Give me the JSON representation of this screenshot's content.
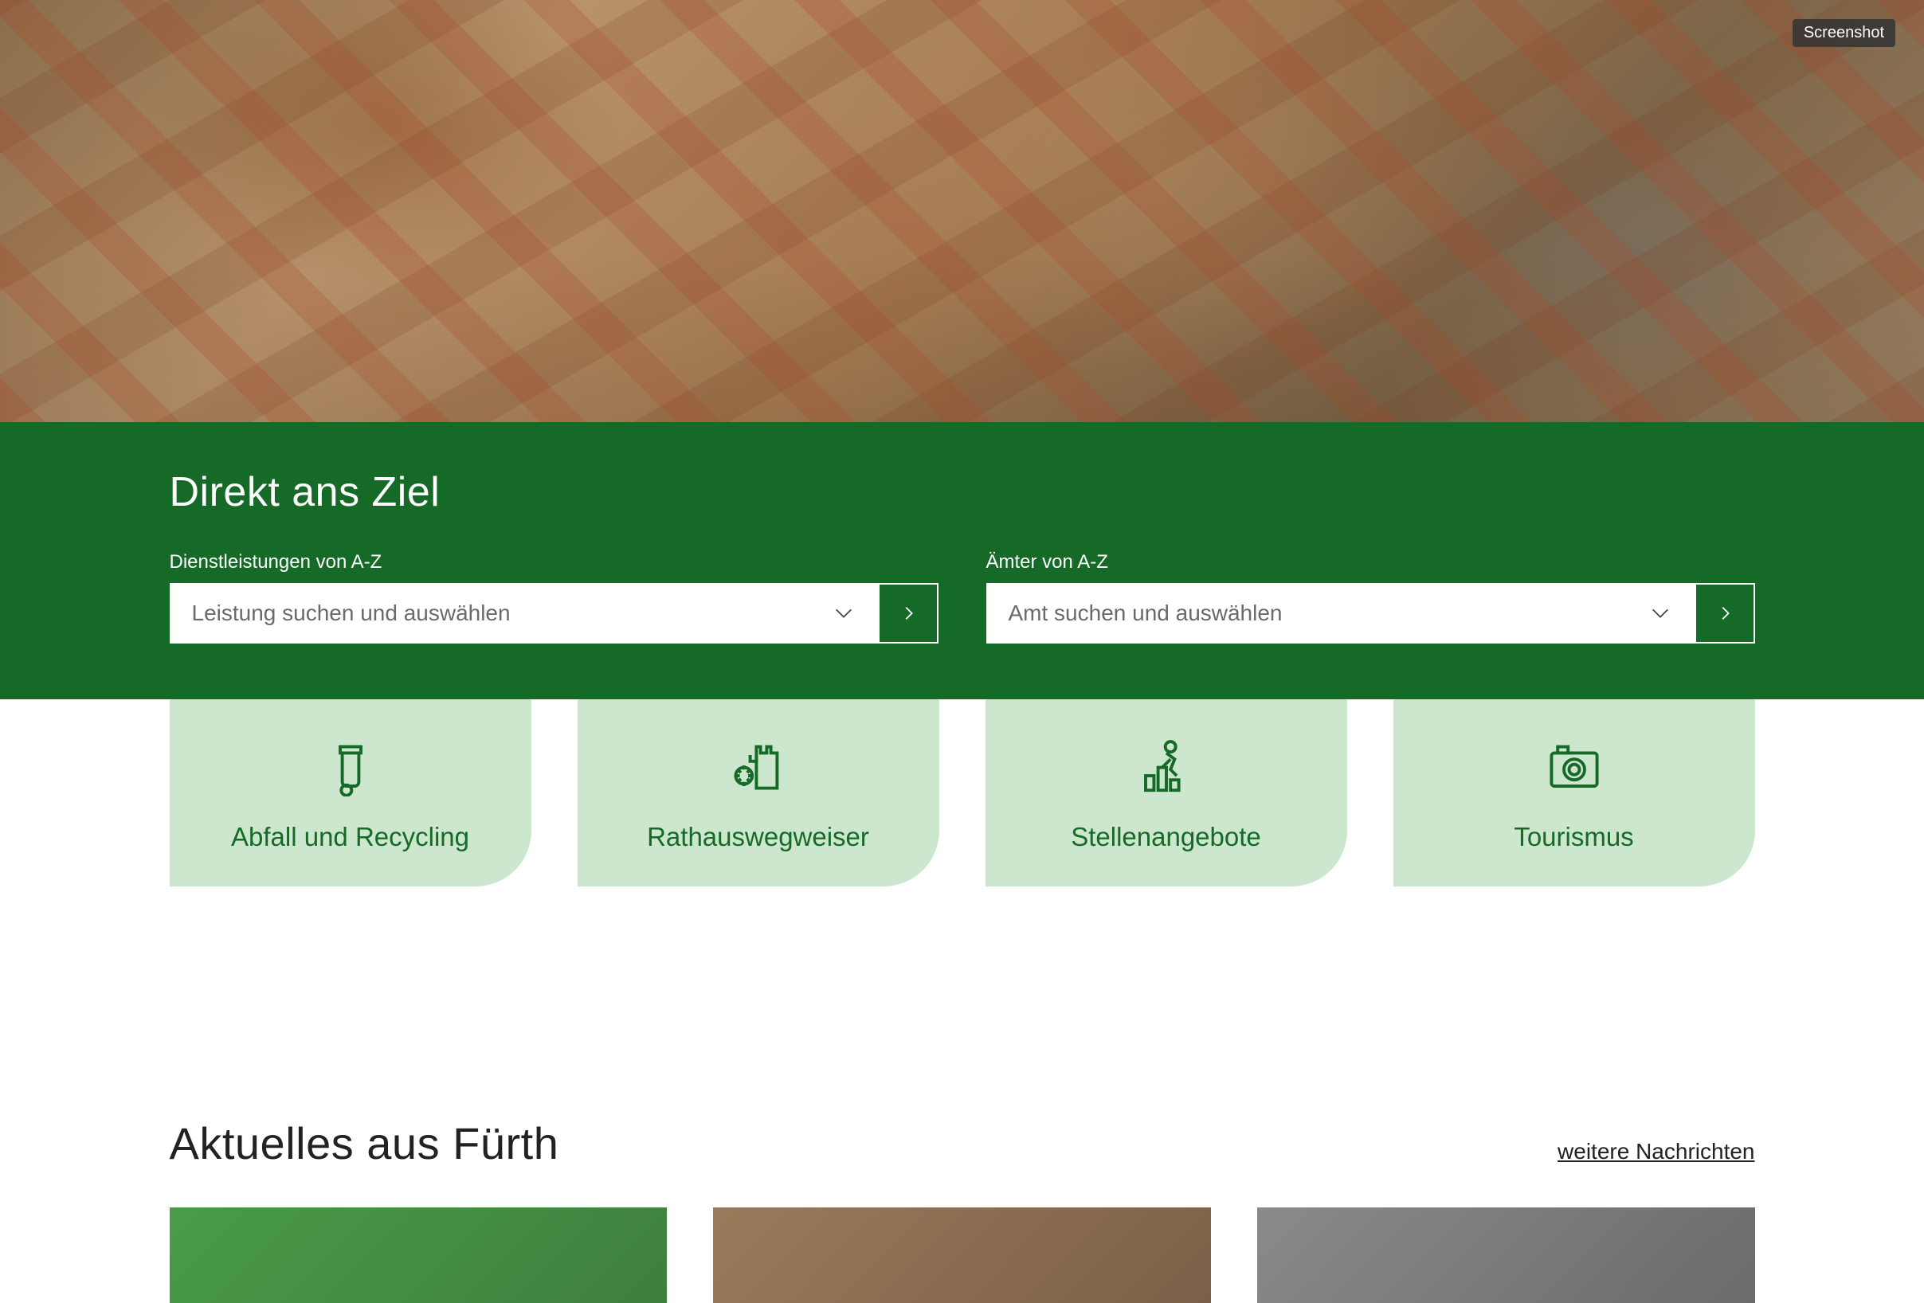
{
  "screenshot_tag": "Screenshot",
  "green_band": {
    "title": "Direkt ans Ziel",
    "services": {
      "label": "Dienstleistungen von A-Z",
      "placeholder": "Leistung suchen und auswählen"
    },
    "offices": {
      "label": "Ämter von A-Z",
      "placeholder": "Amt suchen und auswählen"
    }
  },
  "tiles": [
    {
      "icon": "trash-icon",
      "label": "Abfall und Recycling"
    },
    {
      "icon": "castle-gear-icon",
      "label": "Rathauswegweiser"
    },
    {
      "icon": "jobs-chart-icon",
      "label": "Stellenangebote"
    },
    {
      "icon": "camera-icon",
      "label": "Tourismus"
    }
  ],
  "news": {
    "title": "Aktuelles aus Fürth",
    "more_label": "weitere Nachrichten"
  },
  "colors": {
    "primary": "#166a27",
    "tile_bg": "#cce7cd"
  }
}
